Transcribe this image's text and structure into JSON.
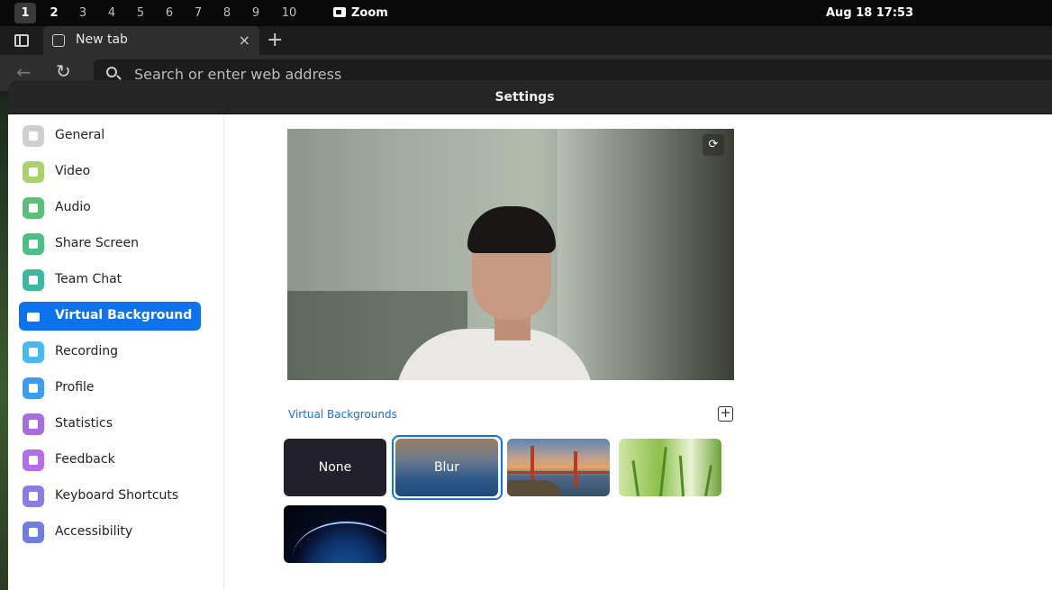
{
  "topbar": {
    "workspaces": [
      "1",
      "2",
      "3",
      "4",
      "5",
      "6",
      "7",
      "8",
      "9",
      "10"
    ],
    "active_workspace": "1",
    "app_name": "Zoom",
    "clock": "Aug 18  17:53"
  },
  "browser": {
    "tab_title": "New tab",
    "close_glyph": "×",
    "newtab_glyph": "+",
    "back_glyph": "←",
    "reload_glyph": "↻",
    "url_placeholder": "Search or enter web address"
  },
  "settings": {
    "window_title": "Settings",
    "nav": [
      {
        "label": "General",
        "icon": "gear-icon",
        "color": "#cfcfcf"
      },
      {
        "label": "Video",
        "icon": "video-camera-icon",
        "color": "#a8d26b"
      },
      {
        "label": "Audio",
        "icon": "headphones-icon",
        "color": "#5bbf7a"
      },
      {
        "label": "Share Screen",
        "icon": "share-screen-icon",
        "color": "#4cbf86"
      },
      {
        "label": "Team Chat",
        "icon": "chat-bubble-icon",
        "color": "#3fb8a0"
      },
      {
        "label": "Virtual Background",
        "icon": "person-card-icon",
        "color": "#0e72ed"
      },
      {
        "label": "Recording",
        "icon": "record-icon",
        "color": "#49b7f0"
      },
      {
        "label": "Profile",
        "icon": "person-icon",
        "color": "#3b9cf0"
      },
      {
        "label": "Statistics",
        "icon": "bar-chart-icon",
        "color": "#a86be0"
      },
      {
        "label": "Feedback",
        "icon": "smiley-icon",
        "color": "#b46fe6"
      },
      {
        "label": "Keyboard Shortcuts",
        "icon": "keyboard-icon",
        "color": "#8c7be6"
      },
      {
        "label": "Accessibility",
        "icon": "accessibility-icon",
        "color": "#6f7fe0"
      }
    ],
    "selected_nav": "Virtual Background",
    "virtual_backgrounds_label": "Virtual Backgrounds",
    "add_glyph": "+",
    "rotate_glyph": "⟳",
    "backgrounds": [
      {
        "label": "None",
        "selected": false
      },
      {
        "label": "Blur",
        "selected": true
      },
      {
        "label": "",
        "image": "golden-gate-bridge"
      },
      {
        "label": "",
        "image": "grass"
      },
      {
        "label": "",
        "image": "earth-from-space"
      }
    ]
  },
  "colors": {
    "accent": "#0e72ed"
  }
}
